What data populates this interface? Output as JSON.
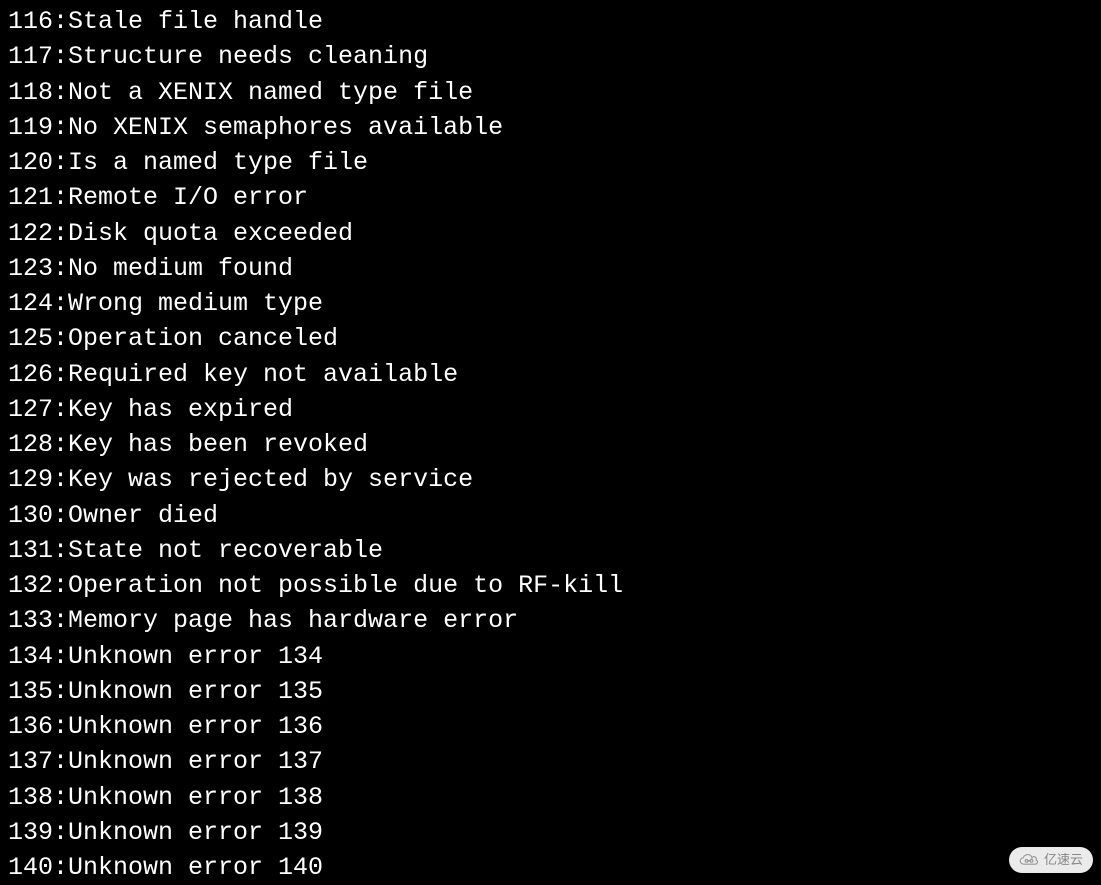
{
  "lines": [
    {
      "code": "116",
      "message": "Stale file handle"
    },
    {
      "code": "117",
      "message": "Structure needs cleaning"
    },
    {
      "code": "118",
      "message": "Not a XENIX named type file"
    },
    {
      "code": "119",
      "message": "No XENIX semaphores available"
    },
    {
      "code": "120",
      "message": "Is a named type file"
    },
    {
      "code": "121",
      "message": "Remote I/O error"
    },
    {
      "code": "122",
      "message": "Disk quota exceeded"
    },
    {
      "code": "123",
      "message": "No medium found"
    },
    {
      "code": "124",
      "message": "Wrong medium type"
    },
    {
      "code": "125",
      "message": "Operation canceled"
    },
    {
      "code": "126",
      "message": "Required key not available"
    },
    {
      "code": "127",
      "message": "Key has expired"
    },
    {
      "code": "128",
      "message": "Key has been revoked"
    },
    {
      "code": "129",
      "message": "Key was rejected by service"
    },
    {
      "code": "130",
      "message": "Owner died"
    },
    {
      "code": "131",
      "message": "State not recoverable"
    },
    {
      "code": "132",
      "message": "Operation not possible due to RF-kill"
    },
    {
      "code": "133",
      "message": "Memory page has hardware error"
    },
    {
      "code": "134",
      "message": "Unknown error 134"
    },
    {
      "code": "135",
      "message": "Unknown error 135"
    },
    {
      "code": "136",
      "message": "Unknown error 136"
    },
    {
      "code": "137",
      "message": "Unknown error 137"
    },
    {
      "code": "138",
      "message": "Unknown error 138"
    },
    {
      "code": "139",
      "message": "Unknown error 139"
    },
    {
      "code": "140",
      "message": "Unknown error 140"
    }
  ],
  "watermark": {
    "text": "亿速云"
  }
}
